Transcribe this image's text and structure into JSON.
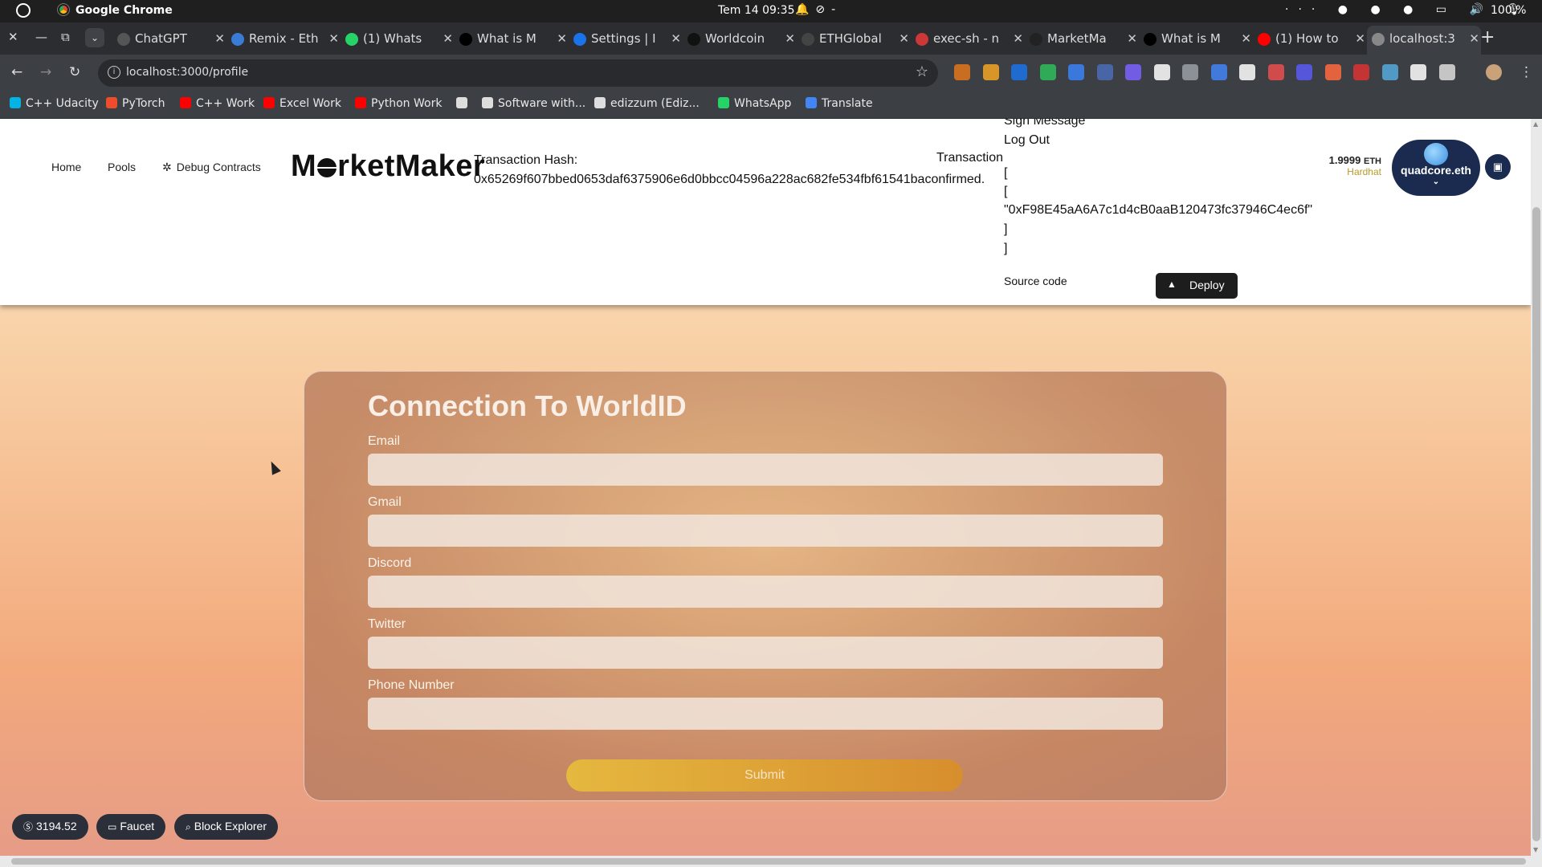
{
  "os": {
    "app_name": "Google Chrome",
    "clock": "Tem 14  09:35",
    "status_suffix": "-",
    "battery": "100 %"
  },
  "tabs": [
    {
      "label": "ChatGPT",
      "icon": "chatgpt-icon",
      "color": "#555"
    },
    {
      "label": "Remix - Eth",
      "icon": "remix-icon",
      "color": "#3a7bd5"
    },
    {
      "label": "(1) Whats",
      "icon": "whatsapp-icon",
      "color": "#25d366"
    },
    {
      "label": "What is M",
      "icon": "medium-icon",
      "color": "#000"
    },
    {
      "label": "Settings | I",
      "icon": "settings-icon",
      "color": "#1a73e8"
    },
    {
      "label": "Worldcoin",
      "icon": "worldcoin-icon",
      "color": "#111"
    },
    {
      "label": "ETHGlobal",
      "icon": "ethglobal-icon",
      "color": "#444"
    },
    {
      "label": "exec-sh - n",
      "icon": "npm-icon",
      "color": "#cb3837"
    },
    {
      "label": "MarketMa",
      "icon": "github-icon",
      "color": "#222"
    },
    {
      "label": "What is M",
      "icon": "medium-icon",
      "color": "#000"
    },
    {
      "label": "(1) How to",
      "icon": "youtube-icon",
      "color": "#f00"
    },
    {
      "label": "localhost:3",
      "icon": "globe-icon",
      "color": "#888"
    }
  ],
  "address_bar": {
    "url": "localhost:3000/profile"
  },
  "bookmarks": [
    {
      "label": "C++ Udacity",
      "color": "#02b3e4"
    },
    {
      "label": "PyTorch",
      "color": "#ee4c2c"
    },
    {
      "label": "C++ Work",
      "color": "#f00"
    },
    {
      "label": "Excel Work",
      "color": "#f00"
    },
    {
      "label": "Python Work",
      "color": "#f00"
    },
    {
      "label": "",
      "color": "#ddd"
    },
    {
      "label": "Software with...",
      "color": "#ddd"
    },
    {
      "label": "edizzum (Ediz...",
      "color": "#ddd"
    },
    {
      "label": "WhatsApp",
      "color": "#25d366"
    },
    {
      "label": "Translate",
      "color": "#4285f4"
    }
  ],
  "header": {
    "nav": [
      "Home",
      "Pools",
      "Debug Contracts"
    ],
    "brand_before": "M",
    "brand_after": "rketMaker",
    "tx_hash_label": "Transaction Hash:",
    "tx_hash_value": "0x65269f607bbed0653daf6375906e6d0bbcc04596a228ac682fe534fbf61541baconfirmed.",
    "tx_label_2": "Transaction",
    "dropdown_lines": [
      "Sign Message",
      "Log Out",
      "[",
      "[",
      "\"0xF98E45aA6A7c1d4cB0aaB120473fc37946C4ec6f\"",
      "]",
      "]"
    ],
    "source_code": "Source code",
    "deploy_label": "Deploy",
    "balance_value": "1.9999",
    "balance_unit": "ETH",
    "network": "Hardhat",
    "account_name": "quadcore.eth"
  },
  "form": {
    "title": "Connection To WorldID",
    "fields": [
      {
        "label": "Email",
        "value": ""
      },
      {
        "label": "Gmail",
        "value": ""
      },
      {
        "label": "Discord",
        "value": ""
      },
      {
        "label": "Twitter",
        "value": ""
      },
      {
        "label": "Phone Number",
        "value": ""
      }
    ],
    "submit_label": "Submit"
  },
  "footer_chips": {
    "price": "3194.52",
    "faucet": "Faucet",
    "explorer": "Block Explorer"
  }
}
